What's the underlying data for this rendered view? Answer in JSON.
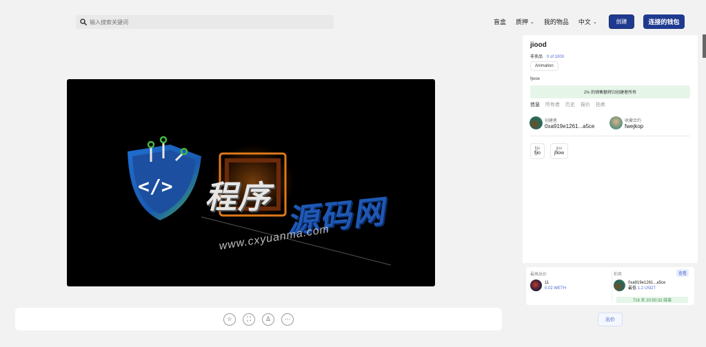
{
  "search": {
    "placeholder": "输入搜索关键词"
  },
  "nav": {
    "blindbox": "盲盒",
    "pledge": "质押",
    "my_items": "我的物品",
    "language": "中文"
  },
  "buttons": {
    "create": "创建",
    "connect_wallet": "连接的钱包"
  },
  "media": {
    "logo_main": "程序",
    "logo_accent": "源码网",
    "logo_url": "www.cxyuanma.com"
  },
  "item": {
    "title": "jiood",
    "type_label": "非卖品",
    "count": "0 of 1000",
    "tag": "Animation",
    "description": "fjwoe",
    "royalty": "2% 的销售额将归创建者所有",
    "tabs": [
      "信息",
      "所有者",
      "历史",
      "报价",
      "拍卖"
    ],
    "creator_label": "创建者",
    "creator_value": "0xa919e1261...a5ce",
    "collection_label": "收藏合约",
    "collection_value": "fwejkop",
    "props": [
      {
        "key": "fjio",
        "value": "fjio"
      },
      {
        "key": "jios",
        "value": "jfiow"
      }
    ]
  },
  "bids": {
    "highest_label": "最高出价",
    "highest_user": "11",
    "highest_amount": "0.02 WETH",
    "auction_label": "拍卖",
    "view": "查看",
    "auction_user": "0xa919e1261...a5ce",
    "min_label": "最低",
    "min_amount": "1.2 USDT",
    "countdown": "718 天 20:50:32 结束"
  },
  "offer_button": "出价"
}
